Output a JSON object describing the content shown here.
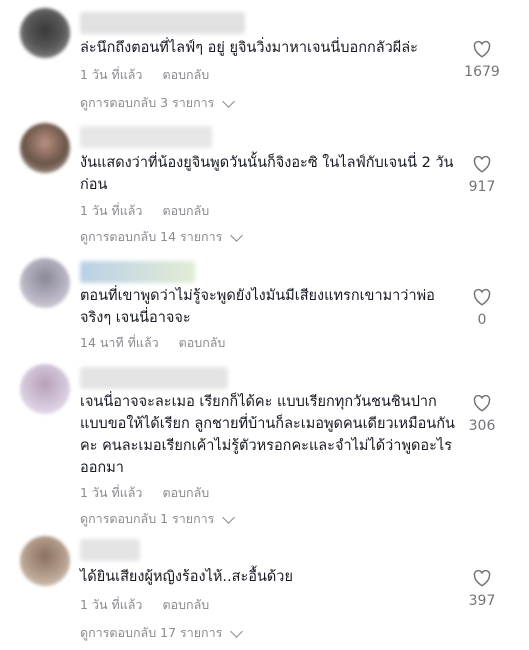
{
  "comments": [
    {
      "text": "ล่ะนึกถึงตอนที่ไลฟ์ๆ อยู่ ยูจินวิ่งมาหาเจนนี่บอกกลัวผีล่ะ",
      "time": "1 วัน ที่แล้ว",
      "reply_label": "ตอบกลับ",
      "view_replies": "ดูการตอบกลับ 3 รายการ",
      "likes": "1679"
    },
    {
      "text": "งันแสดงว่าที่น้องยูจินพูดวันนั้นก็จิงอะซิ ในไลฟ์กับเจนนี่ 2 วันก่อน",
      "time": "1 วัน ที่แล้ว",
      "reply_label": "ตอบกลับ",
      "view_replies": "ดูการตอบกลับ 14 รายการ",
      "likes": "917"
    },
    {
      "text": "ตอนที่เขาพูดว่าไม่รู้จะพูดยังไงมันมีเสียงแทรกเขามาว่าพ่อ จริงๆ เจนนี่อาจจะ",
      "time": "14 นาที ที่แล้ว",
      "reply_label": "ตอบกลับ",
      "view_replies": "",
      "likes": "0"
    },
    {
      "text": "เจนนี่อาจจะละเมอ เรียกก็ได้คะ แบบเรียกทุกวันชนชินปาก แบบขอให้ได้เรียก ลูกชายที่บ้านก็ละเมอพูดคนเดียวเหมือนกันคะ คนละเมอเรียกเค้าไม่รู้ตัวหรอกคะและจำไม่ได้ว่าพูดอะไรออกมา",
      "time": "1 วัน ที่แล้ว",
      "reply_label": "ตอบกลับ",
      "view_replies": "ดูการตอบกลับ 1 รายการ",
      "likes": "306"
    },
    {
      "text": "ได้ยินเสียงผู้หญิงร้องไห้..สะอื้นด้วย",
      "time": "1 วัน ที่แล้ว",
      "reply_label": "ตอบกลับ",
      "view_replies": "ดูการตอบกลับ 17 รายการ",
      "likes": "397"
    }
  ],
  "icons": {
    "like": "heart-outline-icon",
    "expand": "chevron-down-icon"
  },
  "colors": {
    "text": "#161823",
    "muted": "#8a8b91",
    "icon": "#73747b"
  }
}
